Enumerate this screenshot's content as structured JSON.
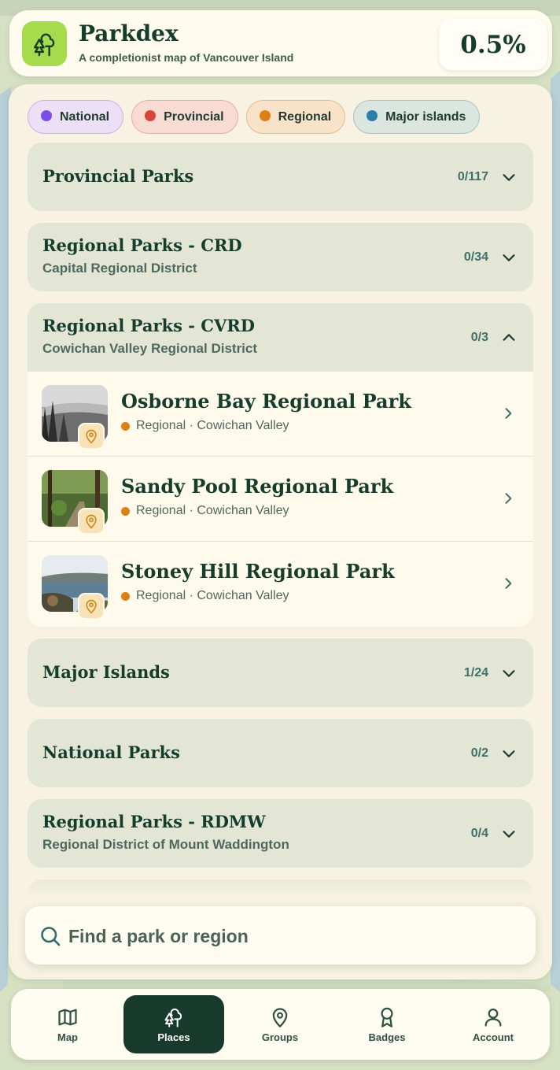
{
  "app": {
    "title": "Parkdex",
    "subtitle": "A completionist map of Vancouver Island",
    "progress": "0.5%"
  },
  "filters": [
    {
      "label": "National",
      "color": "#7c4ee8"
    },
    {
      "label": "Provincial",
      "color": "#d9433b"
    },
    {
      "label": "Regional",
      "color": "#dc7f14"
    },
    {
      "label": "Major islands",
      "color": "#2a7fa8"
    }
  ],
  "sections": {
    "provincial": {
      "title": "Provincial Parks",
      "count": "0/117"
    },
    "crd": {
      "title": "Regional Parks - CRD",
      "subtitle": "Capital Regional District",
      "count": "0/34"
    },
    "cvrd": {
      "title": "Regional Parks - CVRD",
      "subtitle": "Cowichan Valley Regional District",
      "count": "0/3",
      "items": [
        {
          "name": "Osborne Bay Regional Park",
          "meta": "Regional · Cowichan Valley"
        },
        {
          "name": "Sandy Pool Regional Park",
          "meta": "Regional · Cowichan Valley"
        },
        {
          "name": "Stoney Hill Regional Park",
          "meta": "Regional · Cowichan Valley"
        }
      ]
    },
    "islands": {
      "title": "Major Islands",
      "count": "1/24"
    },
    "national": {
      "title": "National Parks",
      "count": "0/2"
    },
    "rdmw": {
      "title": "Regional Parks - RDMW",
      "subtitle": "Regional District of Mount Waddington",
      "count": "0/4"
    }
  },
  "search": {
    "placeholder": "Find a park or region"
  },
  "nav": {
    "map": "Map",
    "places": "Places",
    "groups": "Groups",
    "badges": "Badges",
    "account": "Account"
  },
  "colors": {
    "accent": "#183a2c",
    "logo": "#a6dc4c",
    "regional": "#dc7f14"
  }
}
